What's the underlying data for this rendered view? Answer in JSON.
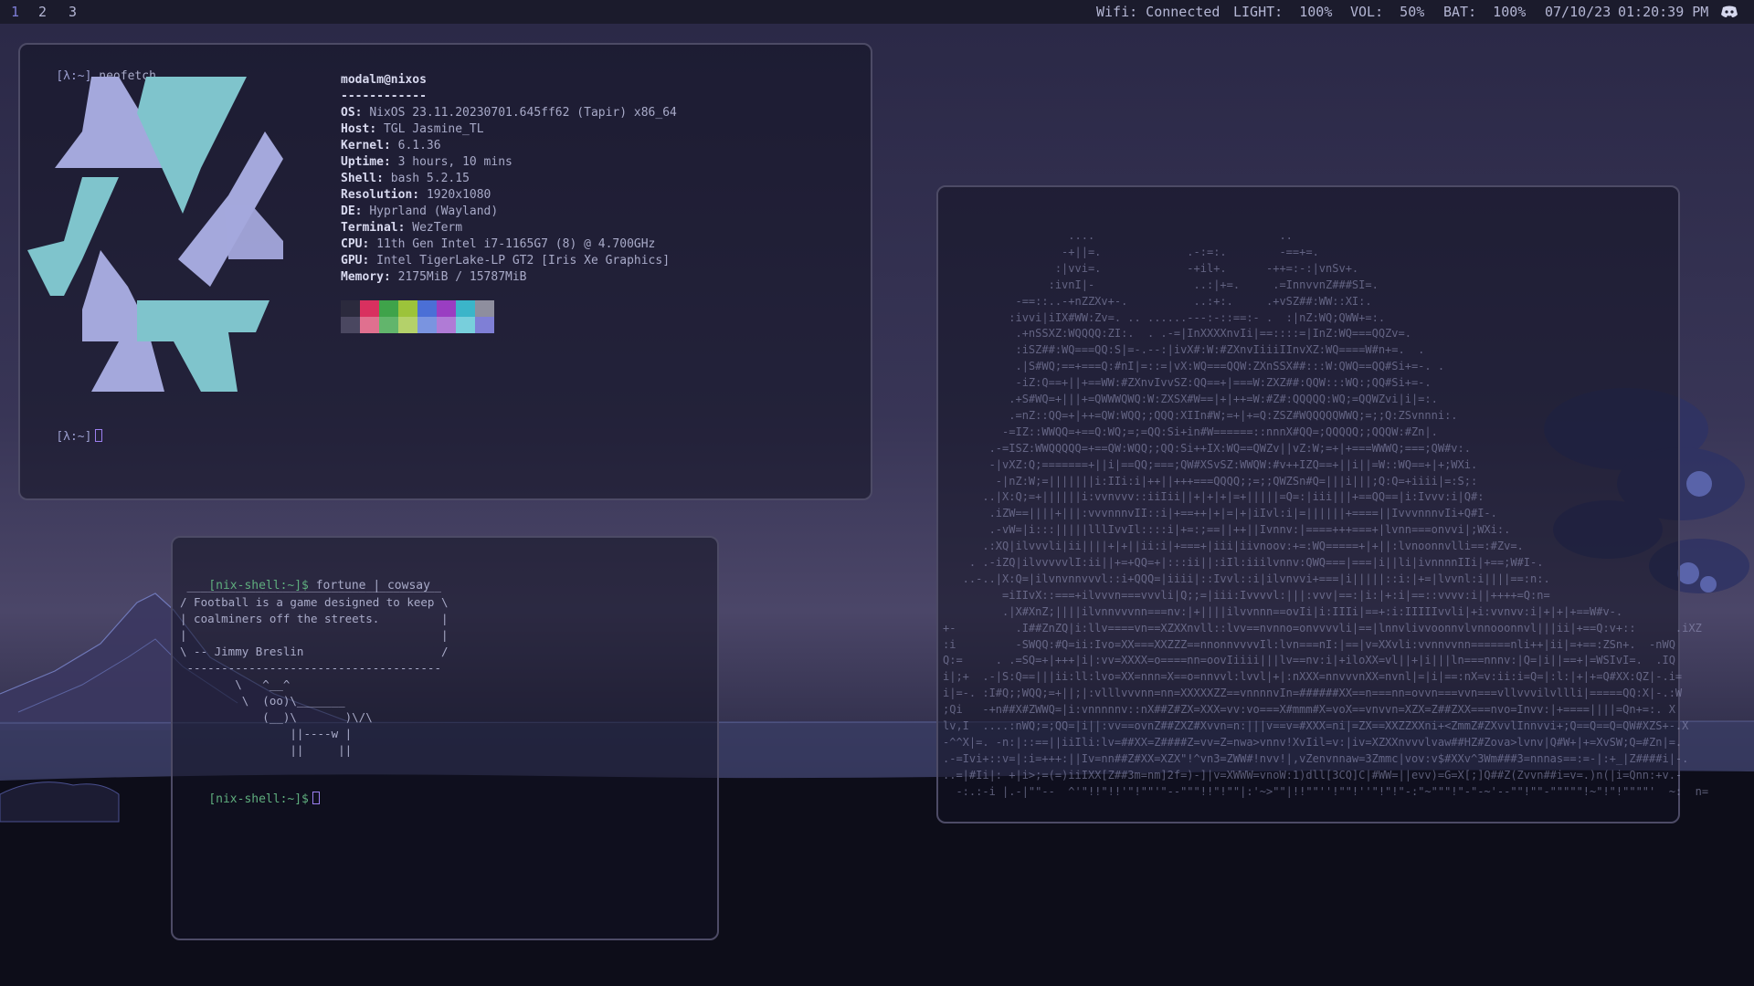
{
  "topbar": {
    "workspaces": [
      "1",
      "2",
      "3"
    ],
    "active_workspace": "1",
    "wifi": "Wifi: Connected",
    "light": "LIGHT:  100%",
    "vol": "VOL:  50%",
    "bat": "BAT:  100%",
    "date": "07/10/23",
    "time": "01:20:39 PM",
    "tray_icon": "discord-icon"
  },
  "neofetch": {
    "prompt": "[λ:~]",
    "command": "neofetch",
    "user": "modalm@nixos",
    "separator": "------------",
    "info": [
      {
        "key": "OS",
        "value": "NixOS 23.11.20230701.645ff62 (Tapir) x86_64"
      },
      {
        "key": "Host",
        "value": "TGL Jasmine_TL"
      },
      {
        "key": "Kernel",
        "value": "6.1.36"
      },
      {
        "key": "Uptime",
        "value": "3 hours, 10 mins"
      },
      {
        "key": "Shell",
        "value": "bash 5.2.15"
      },
      {
        "key": "Resolution",
        "value": "1920x1080"
      },
      {
        "key": "DE",
        "value": "Hyprland (Wayland)"
      },
      {
        "key": "Terminal",
        "value": "WezTerm"
      },
      {
        "key": "CPU",
        "value": "11th Gen Intel i7-1165G7 (8) @ 4.700GHz"
      },
      {
        "key": "GPU",
        "value": "Intel TigerLake-LP GT2 [Iris Xe Graphics]"
      },
      {
        "key": "Memory",
        "value": "2175MiB / 15787MiB"
      }
    ],
    "palette_top": [
      "#2b2a3d",
      "#d9305f",
      "#3fa34a",
      "#9cc33a",
      "#4b6fd6",
      "#9a3ec2",
      "#3bb5c9",
      "#8e8e9e"
    ],
    "palette_bottom": [
      "#4a4760",
      "#e0708f",
      "#62b56c",
      "#b4d16a",
      "#7a94e0",
      "#b07bd6",
      "#78cfdc",
      "#7f7fd6"
    ],
    "logo_colors": {
      "light": "#a4a8dc",
      "teal": "#7fc4cc"
    },
    "second_prompt": "[λ:~]"
  },
  "cowsay": {
    "prompt": "[nix-shell:~]$",
    "command": "fortune | cowsay",
    "lines": [
      " _____________________________________",
      "/ Football is a game designed to keep \\",
      "| coalminers off the streets.         |",
      "|                                     |",
      "\\ -- Jimmy Breslin                    /",
      " -------------------------------------",
      "        \\   ^__^",
      "         \\  (oo)\\_______",
      "            (__)\\       )\\/\\",
      "                ||----w |",
      "                ||     ||"
    ],
    "second_prompt": "[nix-shell:~]$"
  },
  "ascii_art": {
    "lines": [
      "                   ....                            ..",
      "                  -+||=.             .-:=:.        -==+=.",
      "                 :|vvi=.             -+il+.      -++=:-:|vnSv+.",
      "                :ivnI|-               ..:|+=.     .=InnvvnZ###SI=.",
      "           -==::..-+nZZXv+-.          ..:+:.     .+vSZ##:WW::XI:.",
      "          :ivvi|iIX#WW:Zv=. .. ......---:-::==:- .  :|nZ:WQ;QWW+=:.",
      "           .+nSSXZ:WQQQQ:ZI:.  . .-=|InXXXXnvIi|==::::=|InZ:WQ===QQZv=.",
      "           :iSZ##:WQ===QQ:S|=-.--:|ivX#:W:#ZXnvIiiiIInvXZ:WQ====W#n+=.  .",
      "           .|S#WQ;==+===Q:#nI|=::=|vX:WQ===QQW:ZXnSSX##:::W:QWQ==QQ#Si+=-. .",
      "           -iZ:Q==+||+==WW:#ZXnvIvvSZ:QQ==+|===W:ZXZ##:QQW:::WQ:;QQ#Si+=-.",
      "          .+S#WQ=+|||+=QWWWQWQ:W:ZXSX#W==|+|++=W:#Z#:QQQQQ:WQ;=QQWZvi|i|=:.",
      "          .=nZ::QQ=+|++=QW:WQQ;;QQQ:XIIn#W;=+|+=Q:ZSZ#WQQQQQWWQ;=;;Q:ZSvnnni:.",
      "         -=IZ::WWQQ=+==Q:WQ;=;=QQ:Si+in#W======::nnnX#QQ=;QQQQQ;;QQQW:#Zn|.",
      "       .-=ISZ:WWQQQQQ=+==QW:WQQ;;QQ:Si++IX:WQ==QWZv||vZ:W;=+|+===WWWQ;===;QW#v:.",
      "       -|vXZ:Q;=======+||i|==QQ;===;QW#XSvSZ:WWQW:#v++IZQ==+||i||=W::WQ==+|+;WXi.",
      "        -|nZ:W;=|||||||i:IIi:i|++||+++===QQQQ;;=;;QWZSn#Q=|||i|||;Q:Q=+iiii|=:S;:",
      "      ..|X:Q;=+||||||i:vvnvvv::iiIii||+|+|+|=+|||||=Q=:|iii|||+==QQ==|i:Ivvv:i|Q#:",
      "       .iZW==||||+|||:vvvnnnvII::i|+==++|+|=|+|iIvl:i|=||||||+====||IvvvnnnvIi+Q#I-.",
      "       .-vW=|i:::|||||lllIvvIl::::i|+=:;==||++||Ivnnv:|====+++===+|lvnn===onvvi|;WXi:.",
      "      .:XQ|ilvvvli|ii||||+|+||ii:i|+===+|iii|iivnoov:+=:WQ=====+|+||:lvnoonnvlli==:#Zv=.",
      "    . .-iZQ|ilvvvvvlI:ii||+=+QQ=+|:::ii||:iIl:iiilvnnv:QWQ===|===|i||li|ivnnnnIIi|+==;W#I-.",
      "   ..-..|X:Q=|ilvnvnnvvvl::i+QQQ=|iiii|::Ivvl::i|ilvnvvi+===|i|||||::i:|+=|lvvnl:i||||==:n:.",
      "         =iIIvX::===+ilvvvn===vvvli|Q;;=|iii:Ivvvvl:|||:vvv|==:|i:|+:i|==::vvvv:i||++++=Q:n=",
      "         .|X#XnZ;||||ilvnnvvvnn===nv:|+||||ilvvnnn==ovIi|i:IIIi|==+:i:IIIIIvvli|+i:vvnvv:i|+|+|+==W#v-.",
      "+-         .I##ZnZQ|i:llv====vn==XZXXnvll::lvv==nvnno=onvvvvli|==|lnnvlivvoonnvlvnnooonnvl|||ii|+==Q:v+::      .iXZ",
      ":i         -SWQQ:#Q=ii:Ivo=XX===XXZZZ==nnonnvvvvIl:lvn===nI:|==|v=XXvli:vvnnvvnn======nli++|ii|=+==:ZSn+.  -nWQ",
      "Q:=     . .=SQ=+|+++|i|:vv=XXXX=o====nn=oovIiiii|||lv==nv:i|+iloXX=vl||+|i|||ln===nnnv:|Q=|i||==+|=WSIvI=.  .IQ",
      "i|;+  .-|S:Q==|||ii:ll:lvo=XX=nnn=X==o=nnvvl:lvvl|+|:nXXX=nnvvvnXX=nvnl|=|i|==:nX=v:ii:i=Q=|:l:|+|+=Q#XX:QZ|-.i=",
      "i|=-. :I#Q;;WQQ;=+||;|:vlllvvvnn=nn=XXXXXZZ==vnnnnvIn=######XX==n===nn=ovvn===vvn===vllvvvilvllli|=====QQ:X|-.:W",
      ";Qi   -+n##X#ZWWQ=|i:vnnnnnv::nX##Z#ZX=XXX=vv:vo===X#mmm#X=voX==vnvvn=XZX=Z##ZXX===nvo=Invv:|+====||||=Qn+=:. X",
      "lv,I  ....:nWQ;=;QQ=|i||:vv==ovnZ##ZXZ#Xvvn=n:|||v==v=#XXX=ni|=ZX==XXZZXXni+<ZmmZ#ZXvvlInnvvi+;Q==Q==Q=QW#XZS+-.X",
      "-^^X|=. -n:|::==||iiIli:lv=##XX=Z####Z=vv=Z=nwa>vnnv!XvIil=v:|iv=XZXXnvvvlvaw##HZ#Zova>lvnv|Q#W+|+=XvSW;Q=#Zn|=.",
      ".-=Ivi+::v=|:i=+++:||Iv=nn##Z#XX=XZX\"!^vn3=ZWW#!nvv!|,vZenvnnaw=3Zmmc|vov:v$#XXv^3Wm###3=nnnas==:=-|:+_|Z####i|-.",
      "..=|#Ii|: +|i>;=(=)iiIXX[Z##3m=nm]2f=)-]|v=XWWW=vnoW:1)dll[3CQ]C|#WW=||evv)=G=X[;]Q##Z(Zvvn##i=v=.)n(|i=Qnn:+v.-",
      "  -:.:-i |.-|\"\"--  ^'\"!!\"!!'\"!\"\"'\"--\"\"\"!!\"!\"\"|:'~>\"\"|!!\"\"''!\"\"!''\"!\"!\"-:\"~\"\"\"!\"-\"-~'--\"\"!\"\"-\"\"\"\"\"!~\"!\"!\"\"\"\"'  ~:  n="
    ]
  }
}
